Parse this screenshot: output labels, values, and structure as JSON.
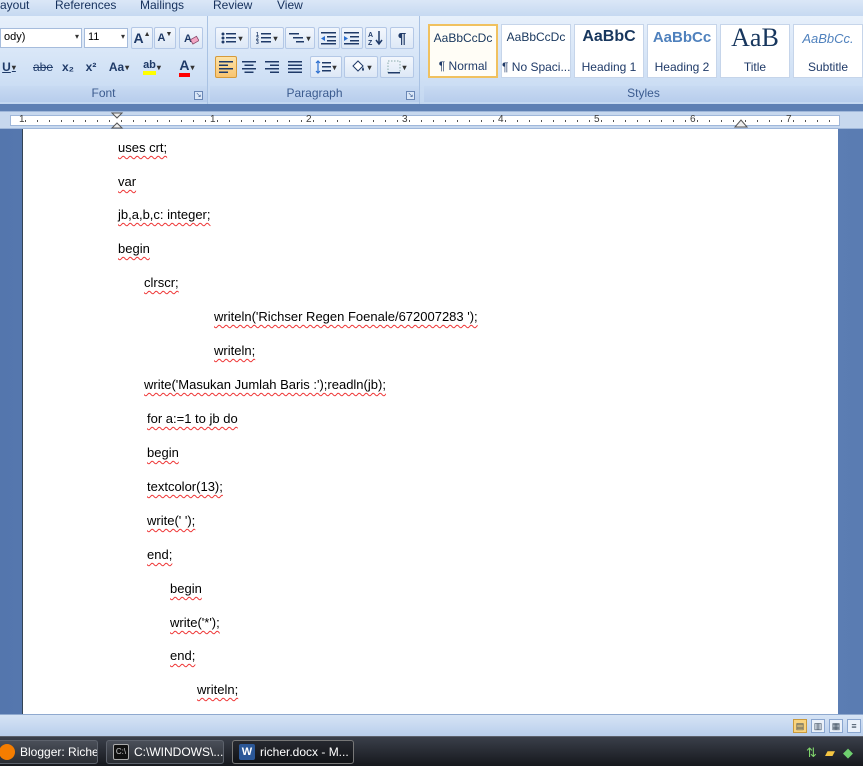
{
  "ribbon_tabs": [
    "ayout",
    "References",
    "Mailings",
    "Review",
    "View"
  ],
  "font_group": {
    "label": "Font",
    "font_name": "ody)",
    "font_size": "11",
    "grow_label": "A",
    "shrink_label": "A",
    "underline_label": "U",
    "strike_label": "abe",
    "subscript_label": "x₂",
    "superscript_label": "x²",
    "case_label": "Aa",
    "highlight_label": "ab",
    "font_color_label": "A",
    "highlight_color": "#ffff00",
    "font_color": "#ff0000"
  },
  "paragraph_group": {
    "label": "Paragraph",
    "pilcrow": "¶"
  },
  "styles_group": {
    "label": "Styles",
    "items": [
      {
        "sample": "AaBbCcDc",
        "name": "¶ Normal"
      },
      {
        "sample": "AaBbCcDc",
        "name": "¶ No Spaci..."
      },
      {
        "sample": "AaBbC",
        "name": "Heading 1"
      },
      {
        "sample": "AaBbCc",
        "name": "Heading 2"
      },
      {
        "sample": "AaB",
        "name": "Title"
      },
      {
        "sample": "AaBbCc.",
        "name": "Subtitle"
      }
    ]
  },
  "ruler_numbers": [
    "1",
    "1",
    "2",
    "3",
    "4",
    "5",
    "6",
    "7"
  ],
  "document": {
    "lines": [
      "uses crt;",
      "var",
      "jb,a,b,c: integer;",
      "begin",
      "clrscr;",
      "writeln('Richser Regen Foenale/672007283 ');",
      "writeln;",
      "write('Masukan Jumlah Baris :');readln(jb);",
      "for a:=1 to jb do",
      "begin",
      "textcolor(13);",
      "write(' ');",
      "end;",
      "begin",
      "write('*');",
      "end;",
      "writeln;"
    ]
  },
  "taskbar": {
    "items": [
      {
        "label": "Blogger: Riche..."
      },
      {
        "label": "C:\\WINDOWS\\..."
      },
      {
        "label": "richer.docx - M..."
      }
    ]
  }
}
